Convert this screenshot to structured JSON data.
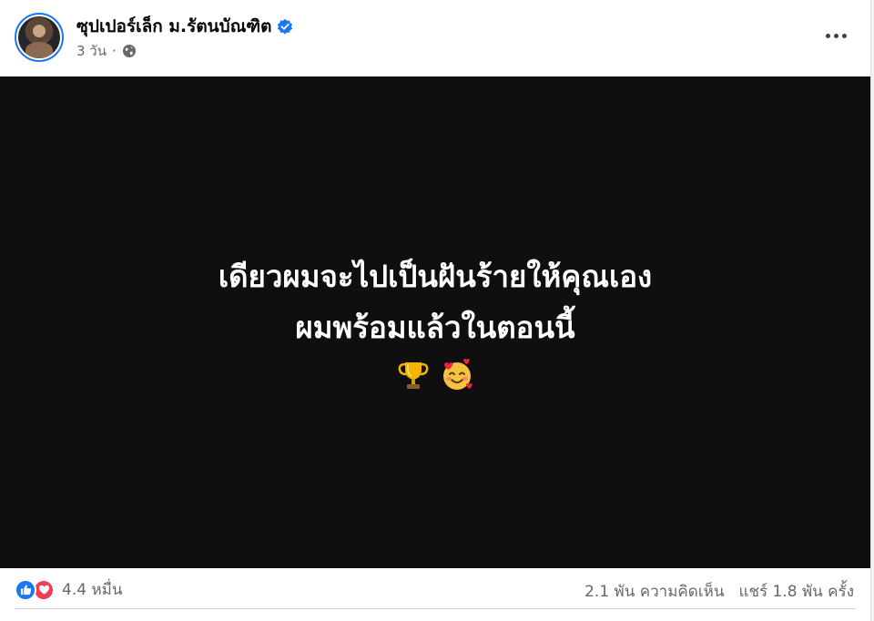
{
  "post": {
    "author_name": "ซุปเปอร์เล็ก ม.รัตนบัณฑิต",
    "timestamp": "3 วัน",
    "icons": {
      "verified": "verified-badge-icon",
      "audience": "globe-icon",
      "more": "more-options-icon"
    },
    "media": {
      "line1": "เดียวผมจะไปเป็นฝันร้ายให้คุณเอง",
      "line2": "ผมพร้อมแล้วในตอนนี้",
      "emoji": [
        "trophy-icon",
        "smiling-face-with-hearts-icon"
      ]
    },
    "reactions": {
      "types": [
        "like",
        "love"
      ],
      "count": "4.4 หมื่น"
    },
    "stats": {
      "comments": "2.1 พัน ความคิดเห็น",
      "shares": "แชร์ 1.8 พัน ครั้ง"
    }
  },
  "colors": {
    "accent": "#1877f2",
    "love": "#f33e58",
    "media_background": "#0f0f10",
    "secondary_text": "#65676b"
  }
}
